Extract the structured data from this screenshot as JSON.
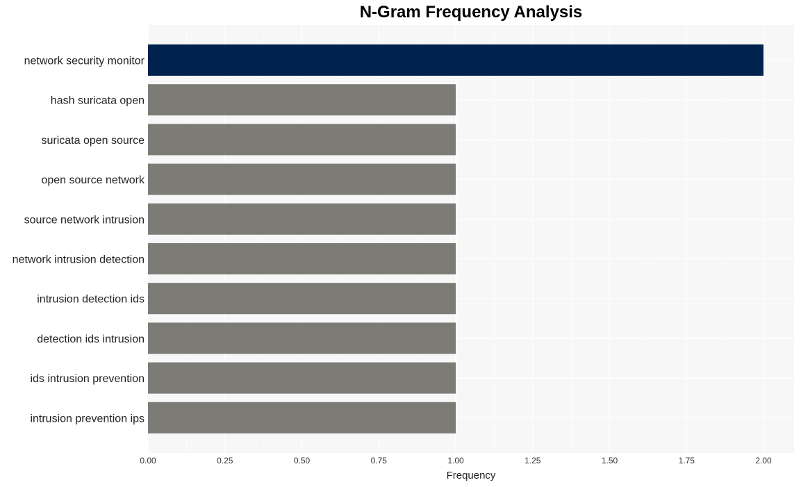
{
  "chart_data": {
    "type": "bar",
    "orientation": "horizontal",
    "title": "N-Gram Frequency Analysis",
    "xlabel": "Frequency",
    "ylabel": "",
    "xlim": [
      0,
      2.1
    ],
    "xticks": [
      0,
      0.25,
      0.5,
      0.75,
      1.0,
      1.25,
      1.5,
      1.75,
      2.0
    ],
    "xtick_labels": [
      "0.00",
      "0.25",
      "0.50",
      "0.75",
      "1.00",
      "1.25",
      "1.50",
      "1.75",
      "2.00"
    ],
    "grid": true,
    "categories": [
      "network security monitor",
      "hash suricata open",
      "suricata open source",
      "open source network",
      "source network intrusion",
      "network intrusion detection",
      "intrusion detection ids",
      "detection ids intrusion",
      "ids intrusion prevention",
      "intrusion prevention ips"
    ],
    "values": [
      2,
      1,
      1,
      1,
      1,
      1,
      1,
      1,
      1,
      1
    ],
    "colors": {
      "highlight": "#00224e",
      "default": "#7c7b76",
      "panel_background": "#f7f7f7",
      "gridline": "#ffffff"
    }
  }
}
